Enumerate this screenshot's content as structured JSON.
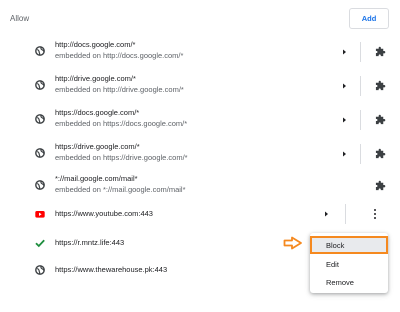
{
  "section": {
    "title": "Allow",
    "add_label": "Add"
  },
  "rows": [
    {
      "primary": "http://docs.google.com/*",
      "secondary": "embedded on http://docs.google.com/*",
      "icon": "globe-icon"
    },
    {
      "primary": "http://drive.google.com/*",
      "secondary": "embedded on http://drive.google.com/*",
      "icon": "globe-icon"
    },
    {
      "primary": "https://docs.google.com/*",
      "secondary": "embedded on https://docs.google.com/*",
      "icon": "globe-icon"
    },
    {
      "primary": "https://drive.google.com/*",
      "secondary": "embedded on https://drive.google.com/*",
      "icon": "globe-icon"
    },
    {
      "primary": "*://mail.google.com/mail*",
      "secondary": "embedded on *://mail.google.com/mail*",
      "icon": "globe-icon"
    },
    {
      "primary": "https://www.youtube.com:443",
      "icon": "youtube-icon"
    },
    {
      "primary": "https://r.mntz.life:443",
      "icon": "checkmark-icon"
    },
    {
      "primary": "https://www.thewarehouse.pk:443",
      "icon": "globe-icon"
    }
  ],
  "menu": {
    "block_label": "Block",
    "edit_label": "Edit",
    "remove_label": "Remove"
  },
  "colors": {
    "accent": "#1a73e8",
    "highlight_border": "#f5891f",
    "check_green": "#1e8e3e",
    "youtube_red": "#ff0000"
  }
}
